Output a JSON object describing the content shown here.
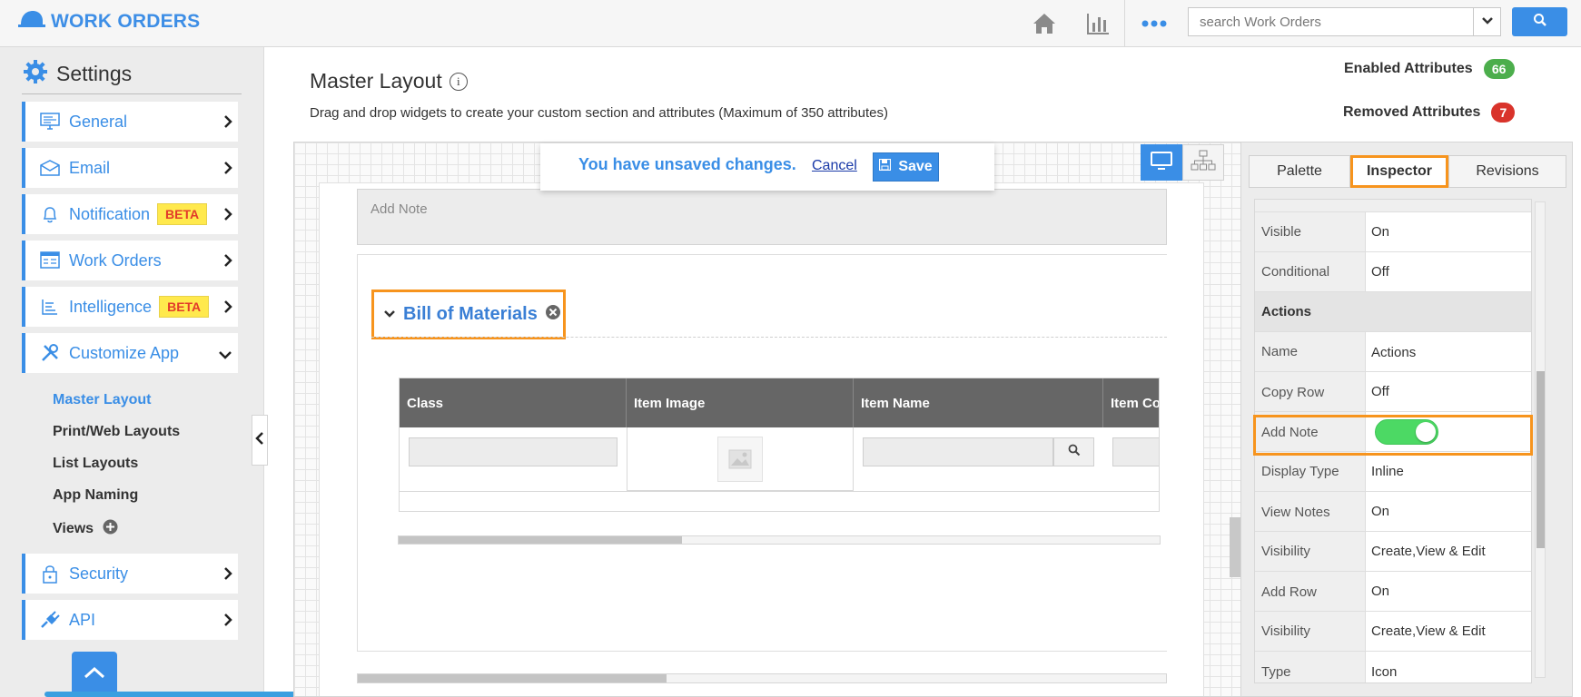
{
  "app": {
    "title": "WORK ORDERS",
    "search": {
      "placeholder": "search Work Orders"
    },
    "top_icons": [
      "home-icon",
      "bar-chart-icon",
      "more-dots-icon"
    ]
  },
  "sidebar": {
    "title": "Settings",
    "items": [
      {
        "label": "General",
        "icon": "monitor-icon"
      },
      {
        "label": "Email",
        "icon": "envelope-icon"
      },
      {
        "label": "Notification",
        "icon": "bell-icon",
        "badge": "BETA"
      },
      {
        "label": "Work Orders",
        "icon": "form-icon"
      },
      {
        "label": "Intelligence",
        "icon": "report-icon",
        "badge": "BETA"
      },
      {
        "label": "Customize App",
        "icon": "tools-icon",
        "expanded": true
      },
      {
        "label": "Security",
        "icon": "lock-icon"
      },
      {
        "label": "API",
        "icon": "plug-icon"
      }
    ],
    "subitems": [
      "Master Layout",
      "Print/Web Layouts",
      "List Layouts",
      "App Naming",
      "Views"
    ],
    "active_subitem": "Master Layout"
  },
  "main": {
    "title": "Master Layout",
    "description": "Drag and drop widgets to create your custom section and attributes (Maximum of 350 attributes)",
    "enabled_attributes": {
      "label": "Enabled Attributes",
      "count": "66",
      "color": "#4cae4c"
    },
    "removed_attributes": {
      "label": "Removed Attributes",
      "count": "7",
      "color": "#d9332b"
    }
  },
  "unsaved": {
    "message": "You have unsaved changes.",
    "cancel": "Cancel",
    "save": "Save"
  },
  "form": {
    "add_note_label": "Add Note",
    "section_title": "Bill of Materials",
    "table_columns": [
      "Class",
      "Item Image",
      "Item Name",
      "Item Co"
    ]
  },
  "panel": {
    "tabs": [
      "Palette",
      "Inspector",
      "Revisions"
    ],
    "active_tab": "Inspector",
    "rows": [
      {
        "key": "Visible",
        "value": "On"
      },
      {
        "key": "Conditional",
        "value": "Off"
      }
    ],
    "group": "Actions",
    "action_rows": [
      {
        "key": "Name",
        "value": "Actions"
      },
      {
        "key": "Copy Row",
        "value": "Off"
      },
      {
        "key": "Add Note",
        "value": "",
        "toggle": true,
        "toggle_on": true
      },
      {
        "key": "Display Type",
        "value": "Inline"
      },
      {
        "key": "View Notes",
        "value": "On"
      },
      {
        "key": "Visibility",
        "value": "Create,View & Edit"
      },
      {
        "key": "Add Row",
        "value": "On"
      },
      {
        "key": "Visibility",
        "value": "Create,View & Edit"
      },
      {
        "key": "Type",
        "value": "Icon"
      }
    ]
  },
  "colors": {
    "accent": "#3a8ee6",
    "highlight": "#f7941d",
    "beta_bg": "#ffe94d",
    "beta_text": "#e23a2a",
    "toggle_on": "#4cd964"
  }
}
